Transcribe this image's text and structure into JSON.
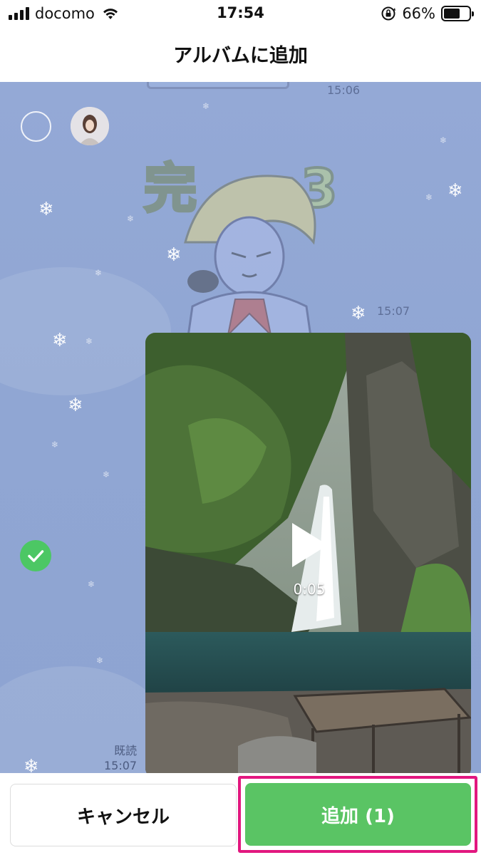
{
  "status_bar": {
    "carrier": "docomo",
    "time": "17:54",
    "battery_percent": "66%",
    "battery_level": 0.66
  },
  "header": {
    "title": "アルバムに追加"
  },
  "chat": {
    "messages": [
      {
        "time": "15:06"
      },
      {
        "time": "15:07"
      },
      {
        "read_label": "既読",
        "time": "15:07",
        "video_duration": "0:05"
      }
    ]
  },
  "footer": {
    "cancel_label": "キャンセル",
    "add_label": "追加 (1)"
  },
  "colors": {
    "accent_green": "#5ac464",
    "check_green": "#4cc764",
    "highlight_pink": "#e2177f",
    "chat_background": "#94a9d6"
  },
  "icons": [
    "signal-icon",
    "wifi-icon",
    "lock-rotation-icon",
    "battery-icon",
    "snowflake-icon",
    "checkmark-icon",
    "play-icon"
  ]
}
